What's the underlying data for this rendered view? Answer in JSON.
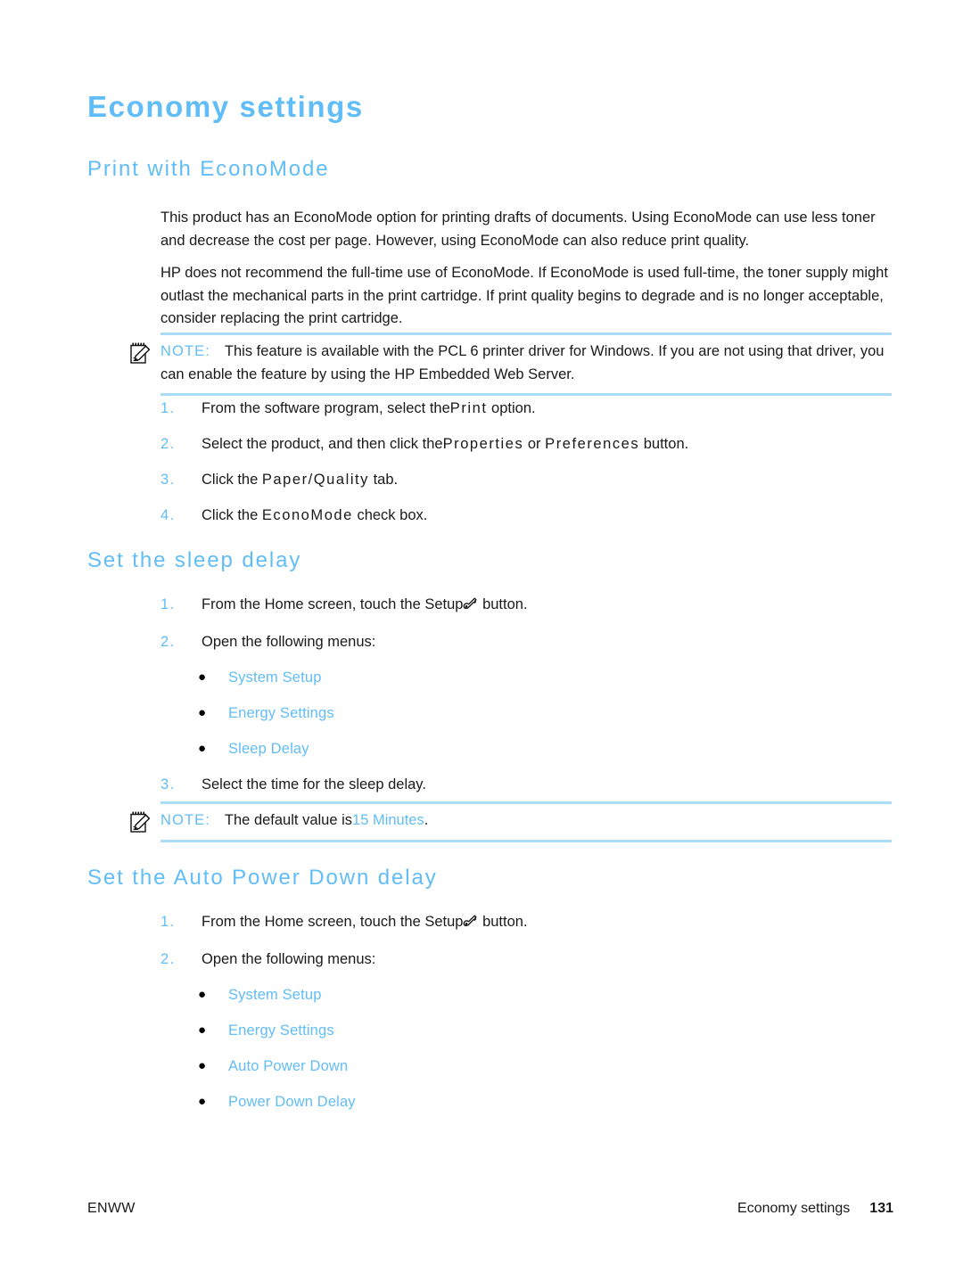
{
  "document": {
    "title": "Economy settings",
    "accent_color": "#61bdf7",
    "note_rule_color": "#aadcf7",
    "text_color": "#1a1a1a"
  },
  "headings": {
    "h1": "Economy settings",
    "econo_mode": "Print with EconoMode",
    "sleep_delay": "Set the sleep delay",
    "auto_power_down": "Set the Auto Power Down delay"
  },
  "paragraphs": {
    "p1_a": "This product has an EconoMode option for printing drafts of documents. Us",
    "p1_b": "ing EconoMode can use less toner and decrease the cost per page. However",
    "p1_c": ", using EconoMode can also reduce print quality.",
    "p2_a": "HP does not recommend the full-time use of EconoM",
    "p2_b": "ode. If EconoMode is used full-time, the toner supply might outlas",
    "p2_c": "t the mechanical parts in the print cartridge",
    "p2_d": ". If print quality begins to degrade and is no longer acceptable, consider replacing the print cartridge."
  },
  "notes": {
    "note1": {
      "label": "NOTE:",
      "text_a": "This feature is available with the PCL 6 printe",
      "text_b": "r driver for Windows. If you are not using that driver, you can enable the feature by using the HP Embedded Web Server.",
      "icon": "note-pad-pencil-icon"
    },
    "note2": {
      "label": "NOTE:",
      "text_a": "The default value is",
      "value": "15 Minutes",
      "text_b": ".",
      "icon": "note-pad-pencil-icon"
    }
  },
  "econo_steps": [
    {
      "num": "1.",
      "text_before": "From the software program, select the",
      "ui_term": "Print",
      "text_after": " option."
    },
    {
      "num": "2.",
      "text_before": "Select the product, and then click the",
      "ui_term": "Properties",
      "text_middle": " or ",
      "ui_term2": "Preferences",
      "text_after": " button."
    },
    {
      "num": "3.",
      "text_before": "Click the ",
      "ui_term": "Paper/Quality",
      "text_after": " tab."
    },
    {
      "num": "4.",
      "text_before": "Click the ",
      "ui_term": "EconoMode",
      "text_after": " check box."
    }
  ],
  "sleep_steps": [
    {
      "num": "1.",
      "text_before": "From the Home screen, touch the Setup",
      "icon": "wrench-icon",
      "text_after": " button."
    },
    {
      "num": "2.",
      "text_before": "Open the following menus:"
    },
    {
      "num": "3.",
      "text_before": "Select the time for the sleep delay."
    }
  ],
  "sleep_menus": [
    "System Setup",
    "Energy Settings",
    "Sleep Delay"
  ],
  "autopower_steps": [
    {
      "num": "1.",
      "text_before": "From the Home screen, touch the Setup",
      "icon": "wrench-icon",
      "text_after": " button."
    },
    {
      "num": "2.",
      "text_before": "Open the following menus:"
    }
  ],
  "autopower_menus": [
    "System Setup",
    "Energy Settings",
    "Auto Power Down",
    "Power Down Delay"
  ],
  "footer": {
    "left": "ENWW",
    "section": "Economy settings",
    "page_number": "131"
  }
}
